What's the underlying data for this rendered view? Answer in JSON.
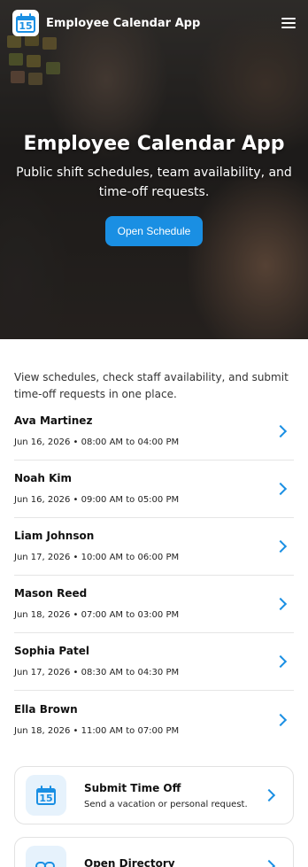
{
  "header": {
    "logo_number": "15",
    "app_title": "Employee Calendar App"
  },
  "hero": {
    "title": "Employee Calendar App",
    "subtitle": "Public shift schedules, team availability, and time-off requests.",
    "button_label": "Open Schedule"
  },
  "intro_text": "View schedules, check staff availability, and submit time-off requests in one place.",
  "shifts": [
    {
      "name": "Ava Martinez",
      "time": "Jun 16, 2026 • 08:00 AM to 04:00 PM"
    },
    {
      "name": "Noah Kim",
      "time": "Jun 16, 2026 • 09:00 AM to 05:00 PM"
    },
    {
      "name": "Liam Johnson",
      "time": "Jun 17, 2026 • 10:00 AM to 06:00 PM"
    },
    {
      "name": "Mason Reed",
      "time": "Jun 18, 2026 • 07:00 AM to 03:00 PM"
    },
    {
      "name": "Sophia Patel",
      "time": "Jun 17, 2026 • 08:30 AM to 04:30 PM"
    },
    {
      "name": "Ella Brown",
      "time": "Jun 18, 2026 • 11:00 AM to 07:00 PM"
    }
  ],
  "cards": [
    {
      "icon": "calendar-icon",
      "icon_number": "15",
      "title": "Submit Time Off",
      "subtitle": "Send a vacation or personal request."
    },
    {
      "icon": "link-icon",
      "title": "Open Directory",
      "subtitle": ""
    }
  ],
  "colors": {
    "accent": "#1a8fe3",
    "icon_bg": "#e6f2fc"
  }
}
